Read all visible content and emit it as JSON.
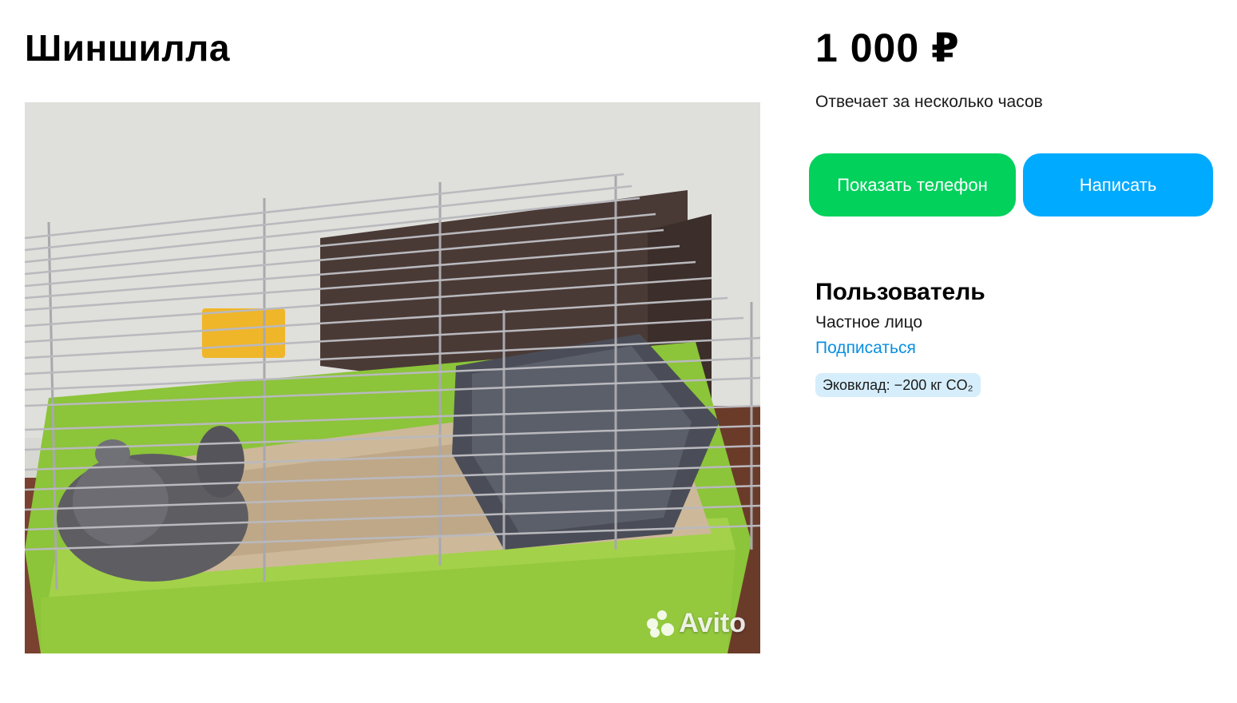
{
  "listing": {
    "title": "Шиншилла",
    "price": "1 000 ₽",
    "response_time": "Отвечает за несколько часов"
  },
  "actions": {
    "show_phone_label": "Показать телефон",
    "write_label": "Написать"
  },
  "seller": {
    "name": "Пользователь",
    "type": "Частное лицо",
    "subscribe_label": "Подписаться",
    "eco_badge": "Эковклад: −200 кг CO₂"
  },
  "photo": {
    "watermark": "Avito",
    "alt": "photo"
  },
  "colors": {
    "show_phone_bg": "#02d15c",
    "write_bg": "#00aaff",
    "link": "#0a8fe0",
    "eco_bg": "#d6eefb"
  },
  "icons": {
    "watermark_logo": "avito-paw-icon"
  }
}
